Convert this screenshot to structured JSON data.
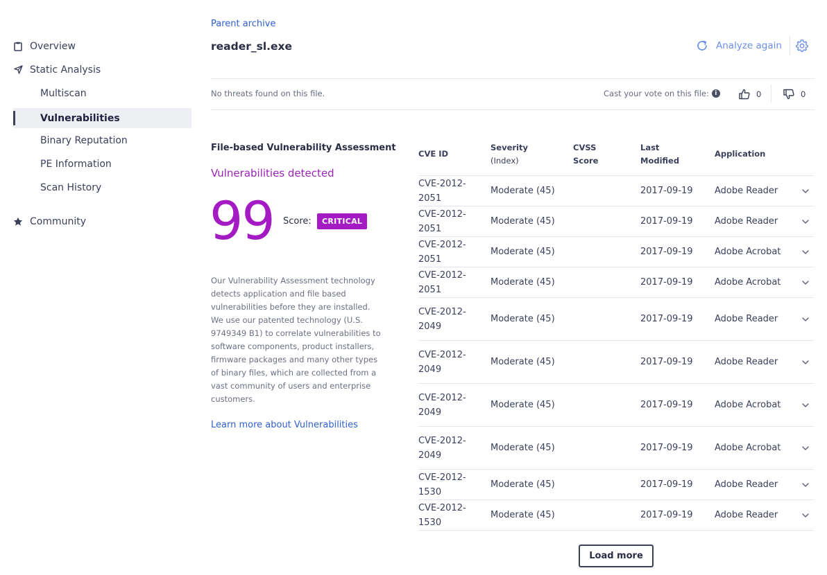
{
  "sidebar": {
    "items": [
      {
        "label": "Overview",
        "icon": "clipboard-icon"
      },
      {
        "label": "Static Analysis",
        "icon": "paper-plane-icon"
      },
      {
        "label": "Multiscan"
      },
      {
        "label": "Vulnerabilities"
      },
      {
        "label": "Binary Reputation"
      },
      {
        "label": "PE Information"
      },
      {
        "label": "Scan History"
      },
      {
        "label": "Community",
        "icon": "star-icon"
      }
    ]
  },
  "header": {
    "parent_link": "Parent archive",
    "file_name": "reader_sl.exe",
    "analyze_again": "Analyze again"
  },
  "status": {
    "no_threats": "No threats found on this file.",
    "vote_label": "Cast your vote on this file:",
    "upvotes": "0",
    "downvotes": "0"
  },
  "assessment": {
    "title": "File-based Vulnerability Assessment",
    "detected": "Vulnerabilities detected",
    "score": "99",
    "score_label": "Score:",
    "badge": "CRITICAL",
    "description": "Our Vulnerability Assessment technology detects application and file based vulnerabilities before they are installed. We use our patented technology (U.S. 9749349 B1) to correlate vulnerabilities to software components, product installers, firmware packages and many other types of binary files, which are collected from a vast community of users and enterprise customers.",
    "learn_more": "Learn more about Vulnerabilities"
  },
  "table": {
    "headers": {
      "cve_id": "CVE ID",
      "severity_1": "Severity",
      "severity_2": "(Index)",
      "cvss_1": "CVSS",
      "cvss_2": "Score",
      "modified_1": "Last",
      "modified_2": "Modified",
      "application": "Application"
    },
    "rows": [
      {
        "cve": "CVE-2012-2051",
        "severity": "Moderate (45)",
        "cvss": "",
        "modified": "2017-09-19",
        "app": "Adobe Reader"
      },
      {
        "cve": "CVE-2012-2051",
        "severity": "Moderate (45)",
        "cvss": "",
        "modified": "2017-09-19",
        "app": "Adobe Reader"
      },
      {
        "cve": "CVE-2012-2051",
        "severity": "Moderate (45)",
        "cvss": "",
        "modified": "2017-09-19",
        "app": "Adobe Acrobat"
      },
      {
        "cve": "CVE-2012-2051",
        "severity": "Moderate (45)",
        "cvss": "",
        "modified": "2017-09-19",
        "app": "Adobe Acrobat"
      },
      {
        "cve": "CVE-2012-2049",
        "severity": "Moderate (45)",
        "cvss": "",
        "modified": "2017-09-19",
        "app": "Adobe Reader"
      },
      {
        "cve": "CVE-2012-2049",
        "severity": "Moderate (45)",
        "cvss": "",
        "modified": "2017-09-19",
        "app": "Adobe Reader"
      },
      {
        "cve": "CVE-2012-2049",
        "severity": "Moderate (45)",
        "cvss": "",
        "modified": "2017-09-19",
        "app": "Adobe Acrobat"
      },
      {
        "cve": "CVE-2012-2049",
        "severity": "Moderate (45)",
        "cvss": "",
        "modified": "2017-09-19",
        "app": "Adobe Acrobat"
      },
      {
        "cve": "CVE-2012-1530",
        "severity": "Moderate (45)",
        "cvss": "",
        "modified": "2017-09-19",
        "app": "Adobe Reader"
      },
      {
        "cve": "CVE-2012-1530",
        "severity": "Moderate (45)",
        "cvss": "",
        "modified": "2017-09-19",
        "app": "Adobe Reader"
      }
    ],
    "load_more": "Load more"
  },
  "colors": {
    "accent_purple": "#a51bc3",
    "link_blue": "#2f5fd0",
    "action_blue": "#6c8ee8"
  }
}
